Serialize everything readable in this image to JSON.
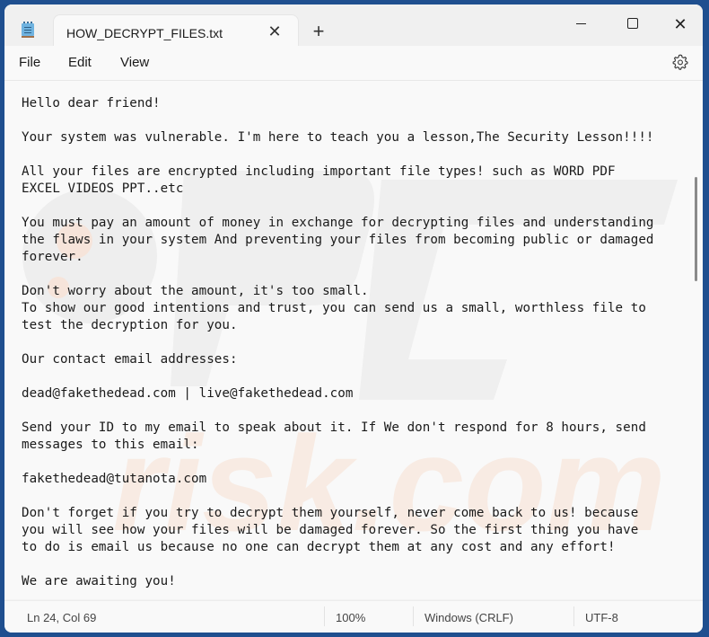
{
  "window": {
    "tab_title": "HOW_DECRYPT_FILES.txt",
    "tab_close_glyph": "✕",
    "new_tab_glyph": "+",
    "close_glyph": "✕"
  },
  "icons": {
    "app": "notepad-icon",
    "settings": "gear-icon"
  },
  "menu": {
    "items": [
      {
        "label": "File"
      },
      {
        "label": "Edit"
      },
      {
        "label": "View"
      }
    ]
  },
  "document": {
    "lines": [
      "Hello dear friend!",
      "",
      "Your system was vulnerable. I'm here to teach you a lesson,The Security Lesson!!!!",
      "",
      "All your files are encrypted including important file types! such as WORD PDF",
      "EXCEL VIDEOS PPT..etc",
      "",
      "You must pay an amount of money in exchange for decrypting files and understanding",
      "the flaws in your system And preventing your files from becoming public or damaged",
      "forever.",
      "",
      "Don't worry about the amount, it's too small.",
      "To show our good intentions and trust, you can send us a small, worthless file to",
      "test the decryption for you.",
      "",
      "Our contact email addresses:",
      "",
      "dead@fakethedead.com | live@fakethedead.com",
      "",
      "Send your ID to my email to speak about it. If We don't respond for 8 hours, send",
      "messages to this email:",
      "",
      "fakethedead@tutanota.com",
      "",
      "Don't forget if you try to decrypt them yourself, never come back to us! because",
      "you will see how your files will be damaged forever. So the first thing you have",
      "to do is email us because no one can decrypt them at any cost and any effort!",
      "",
      "We are awaiting you!"
    ]
  },
  "status": {
    "position": "Ln 24, Col 69",
    "zoom": "100%",
    "line_ending": "Windows (CRLF)",
    "encoding": "UTF-8"
  },
  "watermark": {
    "text": "risk.com"
  },
  "colors": {
    "desktop_bg": "#1f4f8f",
    "editor_bg": "#f9f9f9",
    "titlebar_bg": "#f0f0f0",
    "watermark_gray": "#ececec",
    "watermark_orange": "#f7e7dc"
  }
}
